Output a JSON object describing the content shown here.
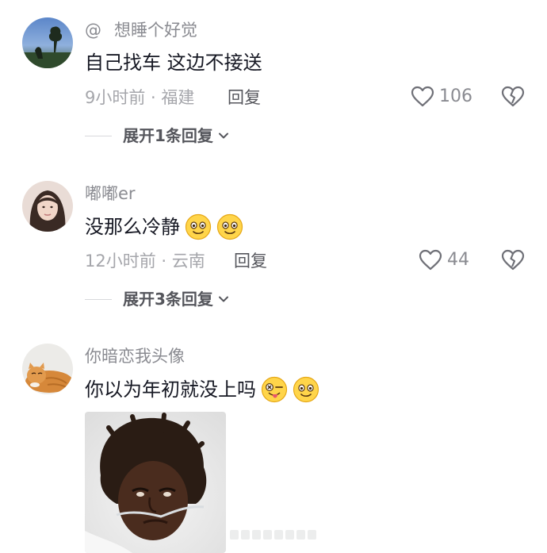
{
  "comments": [
    {
      "at_prefix": "@",
      "username": "想睡个好觉",
      "text": "自己找车 这边不接送",
      "meta": "9小时前 · 福建",
      "reply_label": "回复",
      "likes": "106",
      "expand_label": "展开1条回复"
    },
    {
      "username": "嘟嘟er",
      "text": "没那么冷静",
      "meta": "12小时前 · 云南",
      "reply_label": "回复",
      "likes": "44",
      "expand_label": "展开3条回复"
    },
    {
      "username": "你暗恋我头像",
      "text": "你以为年初就没上吗"
    }
  ]
}
